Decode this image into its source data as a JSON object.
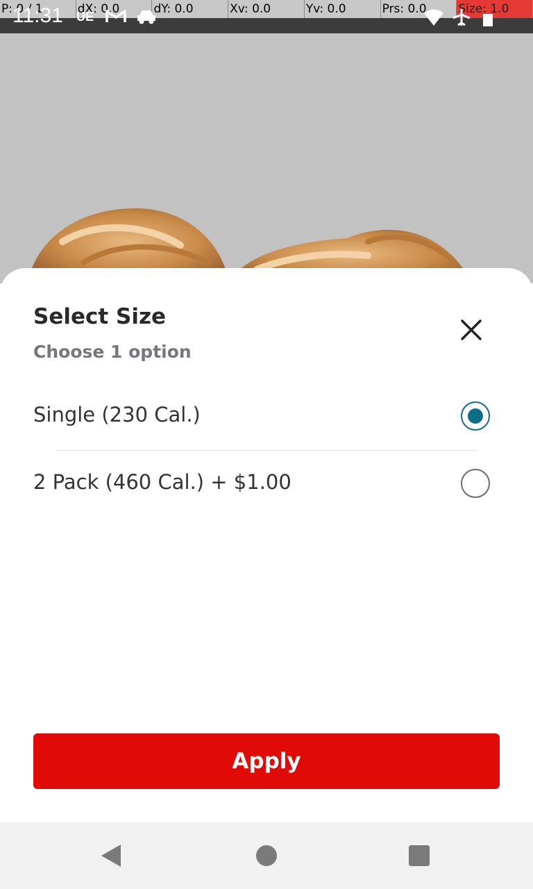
{
  "status_bar": {
    "time": "11:31",
    "icons": [
      "ue-icon",
      "gmail-icon",
      "taxi-icon",
      "wifi-icon",
      "airplane-mode-icon",
      "battery-icon"
    ]
  },
  "debug_overlay": {
    "p": "P: 0 / 1",
    "dx": "dX: 0.0",
    "dy": "dY: 0.0",
    "xv": "Xv: 0.0",
    "yv": "Yv: 0.0",
    "prs": "Prs: 0.0",
    "size": "Size: 1.0"
  },
  "sheet": {
    "title": "Select Size",
    "subtitle": "Choose 1 option",
    "options": [
      {
        "label": "Single (230 Cal.)",
        "selected": true
      },
      {
        "label": "2 Pack (460 Cal.)  + $1.00",
        "selected": false
      }
    ],
    "apply_label": "Apply"
  },
  "colors": {
    "accent_red": "#e00b07",
    "radio_selected": "#0e6e8a",
    "overlay_gray": "#c2c2c2"
  }
}
